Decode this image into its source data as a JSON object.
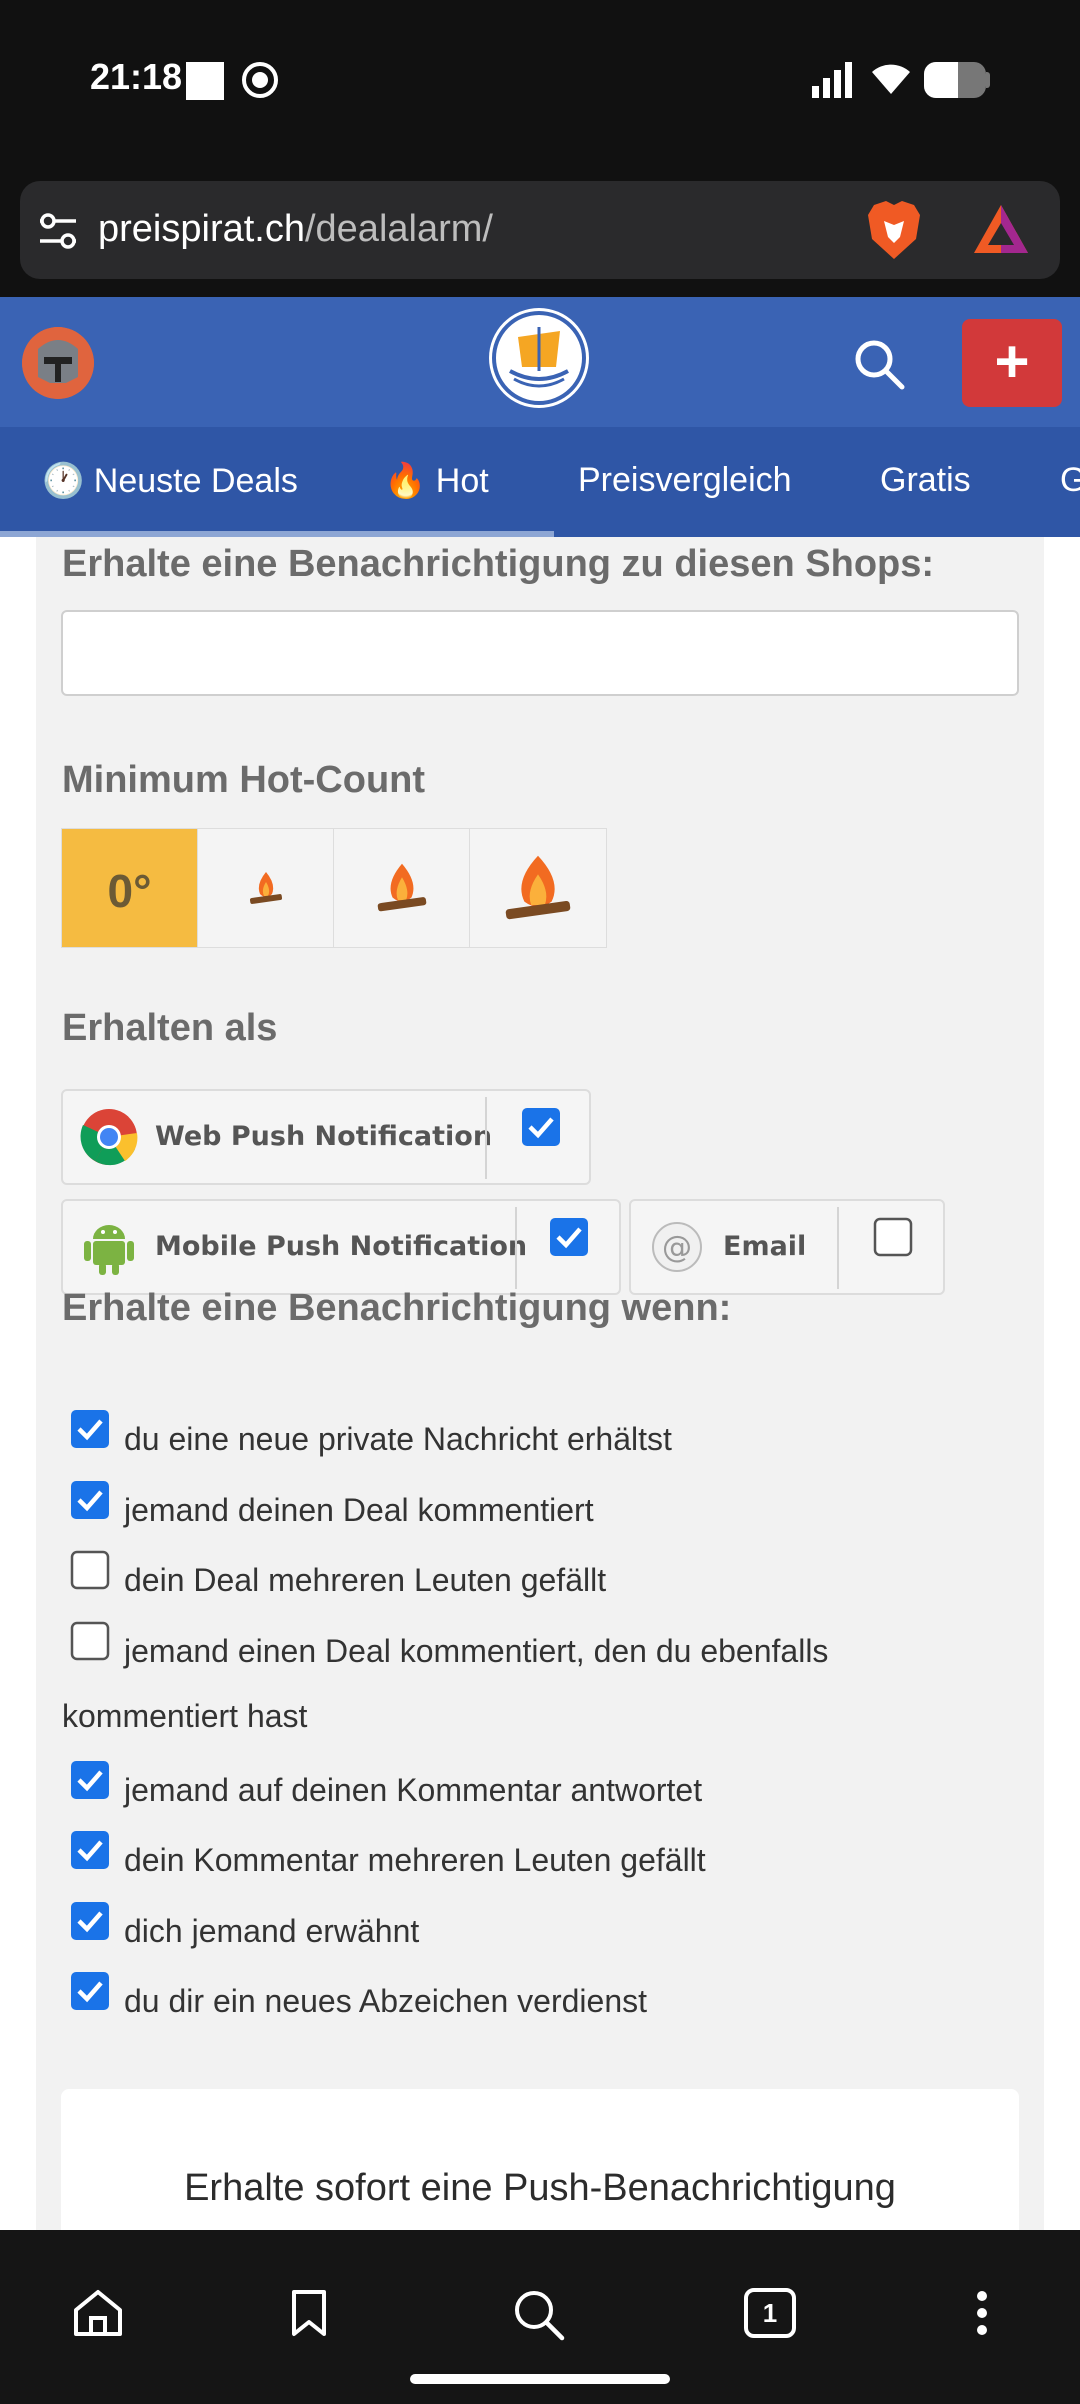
{
  "status": {
    "time": "21:18"
  },
  "browser": {
    "url_domain": "preispirat.ch",
    "url_path": "/dealalarm/",
    "tab_count": "1"
  },
  "site": {
    "nav_tabs": [
      "🕐 Neuste Deals",
      "🔥 Hot",
      "Preisvergleich",
      "Gratis",
      "G"
    ],
    "plus_label": "+"
  },
  "form": {
    "shops_heading": "Erhalte eine Benachrichtigung zu diesen Shops:",
    "shops_value": "",
    "hotcount_heading": "Minimum Hot-Count",
    "hotcount_options": [
      "0°",
      "fire-small",
      "fire-medium",
      "fire-large"
    ],
    "hotcount_selected": "0°",
    "receive_heading": "Erhalten als",
    "channels": [
      {
        "label": "Web Push Notification",
        "checked": true
      },
      {
        "label": "Mobile Push Notification",
        "checked": true
      },
      {
        "label": "Email",
        "checked": false
      }
    ],
    "notify_heading": "Erhalte eine Benachrichtigung wenn:",
    "notify_options": [
      {
        "label": "du eine neue private Nachricht erhältst",
        "checked": true
      },
      {
        "label": "jemand deinen Deal kommentiert",
        "checked": true
      },
      {
        "label": "dein Deal mehreren Leuten gefällt",
        "checked": false
      },
      {
        "label": "jemand einen Deal kommentiert, den du ebenfalls",
        "label_cont": "kommentiert hast",
        "checked": false
      },
      {
        "label": "jemand auf deinen Kommentar antwortet",
        "checked": true
      },
      {
        "label": "dein Kommentar mehreren Leuten gefällt",
        "checked": true
      },
      {
        "label": "dich jemand erwähnt",
        "checked": true
      },
      {
        "label": "du dir ein neues Abzeichen verdienst",
        "checked": true
      }
    ],
    "promo_text": "Erhalte sofort eine Push-Benachrichtigung"
  },
  "colors": {
    "header_blue": "#3a63b4",
    "nav_blue": "#2f56a6",
    "accent_red": "#d2393a",
    "hot_yellow": "#f5bb41",
    "checkbox_blue": "#1a73e8"
  }
}
